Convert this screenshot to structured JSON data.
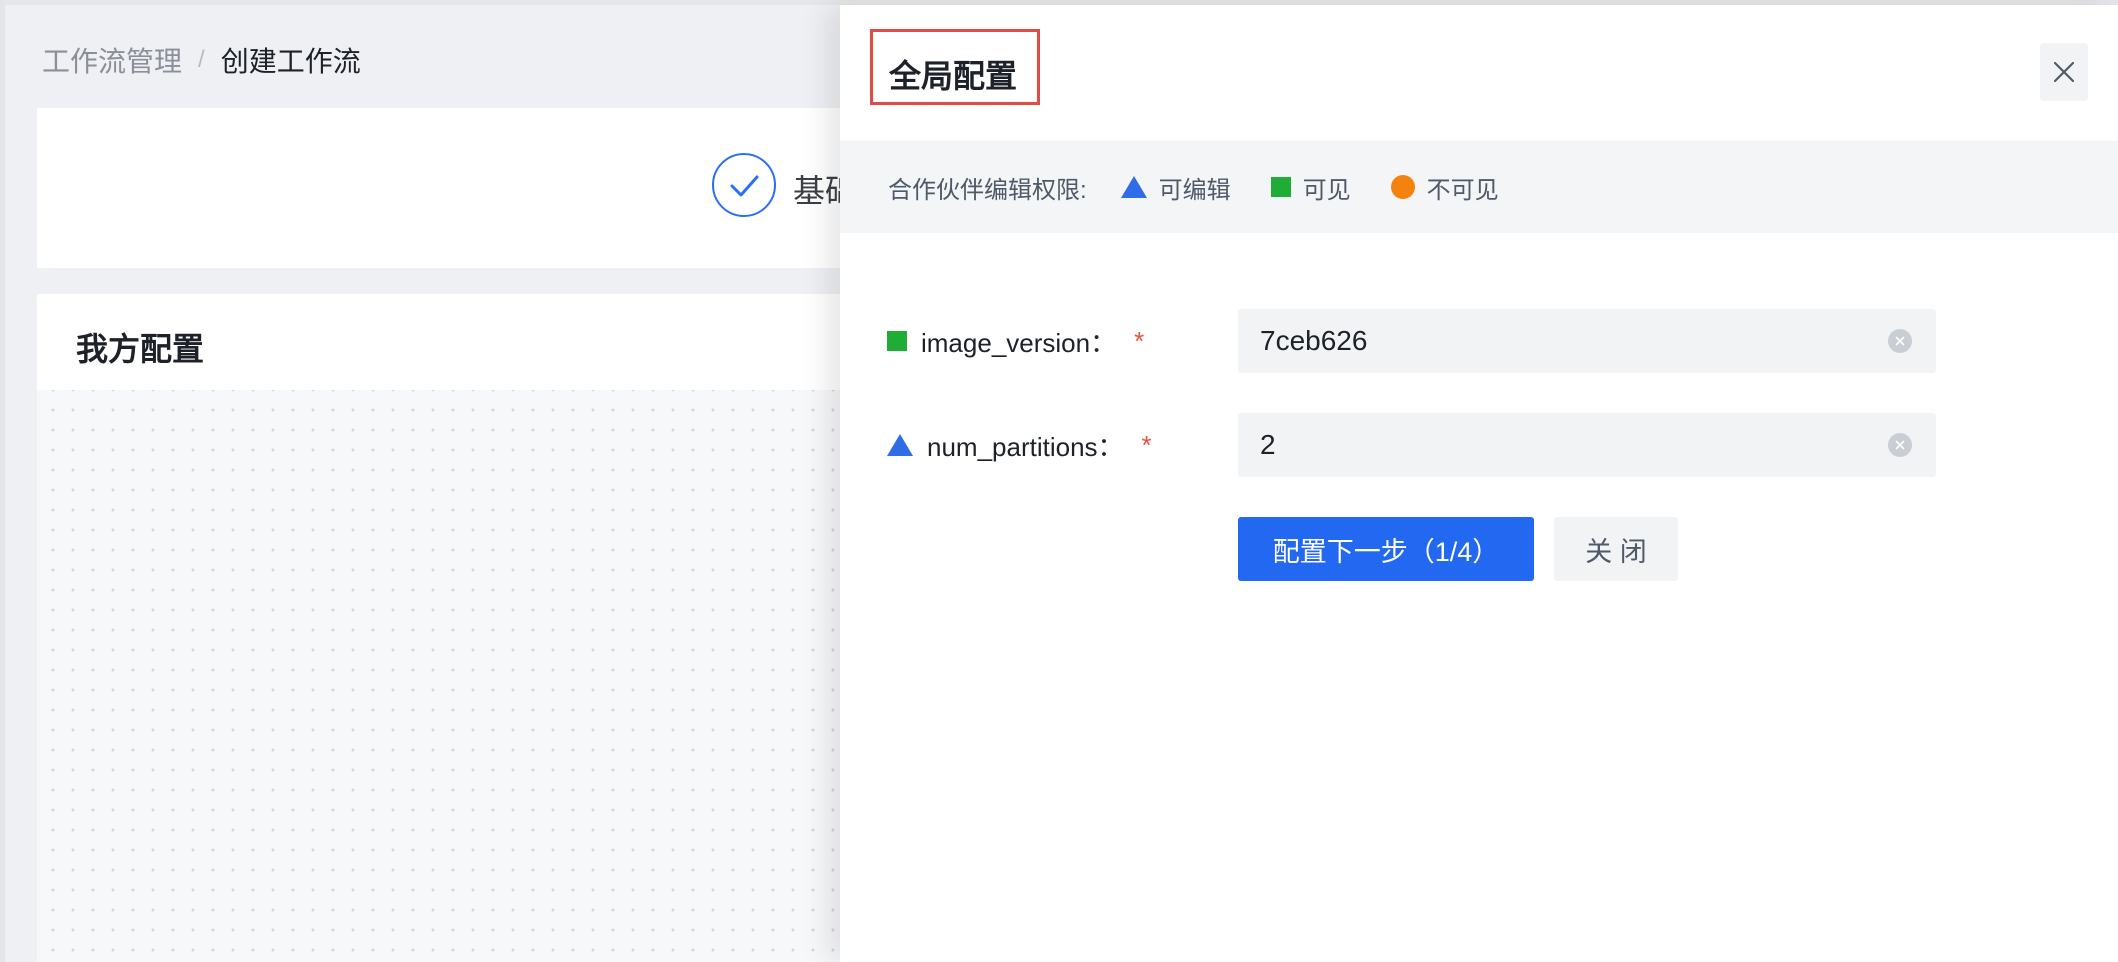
{
  "breadcrumb": {
    "parent": "工作流管理",
    "separator": "/",
    "current": "创建工作流"
  },
  "steps": {
    "first_label": "基础"
  },
  "config_card": {
    "title": "我方配置"
  },
  "drawer": {
    "title": "全局配置",
    "legend": {
      "prefix": "合作伙伴编辑权限:",
      "items": [
        {
          "shape": "triangle",
          "color": "#2f6ce8",
          "label": "可编辑"
        },
        {
          "shape": "square",
          "color": "#1fad36",
          "label": "可见"
        },
        {
          "shape": "circle",
          "color": "#f5820f",
          "label": "不可见"
        }
      ]
    },
    "fields": [
      {
        "permission": "square",
        "label": "image_version：",
        "required": "*",
        "value": "7ceb626"
      },
      {
        "permission": "triangle",
        "label": "num_partitions：",
        "required": "*",
        "value": "2"
      }
    ],
    "buttons": {
      "next_label": "配置下一步（1/4）",
      "close_label": "关 闭"
    }
  },
  "colors": {
    "primary": "#2268f1",
    "required_star": "#e8513f",
    "highlight_border": "#e34a43"
  }
}
